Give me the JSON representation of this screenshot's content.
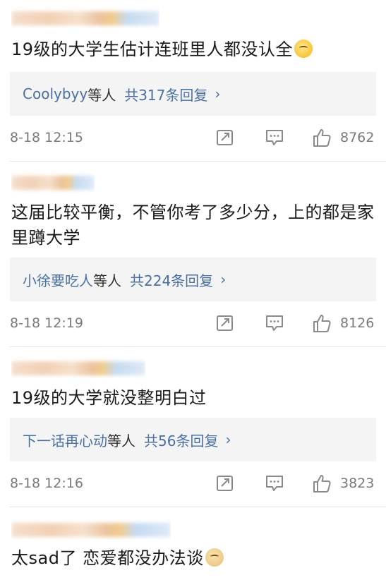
{
  "comments": [
    {
      "text": "19级的大学生估计连班里人都没认全",
      "reply_users": "Coolybyy",
      "reply_etc": "等人",
      "reply_total": "共317条回复",
      "time": "8-18 12:15",
      "likes": "8762"
    },
    {
      "text": "这届比较平衡，不管你考了多少分，上的都是家里蹲大学",
      "reply_users": "小徐要吃人",
      "reply_etc": "等人",
      "reply_total": "共224条回复",
      "time": "8-18 12:19",
      "likes": "8126"
    },
    {
      "text": "19级的大学就没整明白过",
      "reply_users": "下一话再心动",
      "reply_etc": "等人",
      "reply_total": "共56条回复",
      "time": "8-18 12:16",
      "likes": "3823"
    },
    {
      "text": "太sad了 恋爱都没办法谈"
    }
  ],
  "icons": {
    "share": "share-icon",
    "reply": "comment-icon",
    "like": "thumbs-up-icon",
    "chevron": "chevron-right-icon"
  },
  "colors": {
    "link": "#4a6fa5",
    "reply_bg": "#f4f4f4",
    "meta_text": "#7a7a7a"
  }
}
